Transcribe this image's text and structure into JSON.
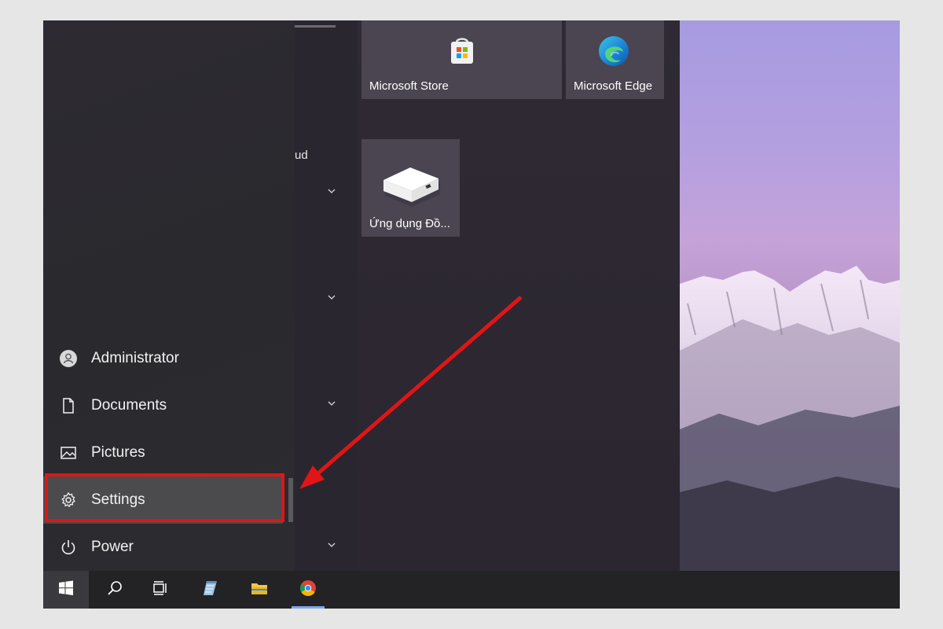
{
  "tiles": {
    "store_label": "Microsoft Store",
    "edge_label": "Microsoft Edge",
    "app_label": "Ứng dụng Đồ..."
  },
  "app_list": {
    "partial_label": "ud"
  },
  "rail": {
    "administrator": "Administrator",
    "documents": "Documents",
    "pictures": "Pictures",
    "settings": "Settings",
    "power": "Power"
  },
  "colors": {
    "highlight": "#e01515",
    "accent_underline": "#7fa7e6"
  },
  "icons": {
    "taskbar": [
      "windows-start-icon",
      "search-icon",
      "task-view-icon",
      "notepad-icon",
      "file-explorer-icon",
      "chrome-icon"
    ]
  }
}
